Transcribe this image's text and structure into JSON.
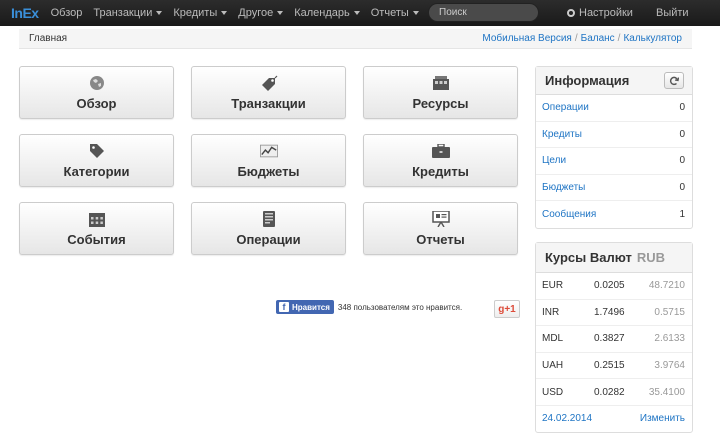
{
  "brand": "InEx",
  "nav": {
    "items": [
      {
        "label": "Обзор",
        "dropdown": false
      },
      {
        "label": "Транзакции",
        "dropdown": true
      },
      {
        "label": "Кредиты",
        "dropdown": true
      },
      {
        "label": "Другое",
        "dropdown": true
      },
      {
        "label": "Календарь",
        "dropdown": true
      },
      {
        "label": "Отчеты",
        "dropdown": true
      }
    ],
    "search_placeholder": "Поиск",
    "settings_label": "Настройки",
    "logout_label": "Выйти"
  },
  "breadcrumb": {
    "current": "Главная",
    "links": [
      "Мобильная Версия",
      "Баланс",
      "Калькулятор"
    ],
    "separator": "/"
  },
  "tiles": [
    {
      "label": "Обзор",
      "icon": "globe-icon"
    },
    {
      "label": "Транзакции",
      "icon": "price-tag-icon"
    },
    {
      "label": "Ресурсы",
      "icon": "building-icon"
    },
    {
      "label": "Категории",
      "icon": "tag-icon"
    },
    {
      "label": "Бюджеты",
      "icon": "chart-icon"
    },
    {
      "label": "Кредиты",
      "icon": "briefcase-icon"
    },
    {
      "label": "События",
      "icon": "calendar-icon"
    },
    {
      "label": "Операции",
      "icon": "receipt-icon"
    },
    {
      "label": "Отчеты",
      "icon": "presentation-icon"
    }
  ],
  "info": {
    "title": "Информация",
    "rows": [
      {
        "label": "Операции",
        "value": "0"
      },
      {
        "label": "Кредиты",
        "value": "0"
      },
      {
        "label": "Цели",
        "value": "0"
      },
      {
        "label": "Бюджеты",
        "value": "0"
      },
      {
        "label": "Сообщения",
        "value": "1"
      }
    ]
  },
  "rates": {
    "title": "Курсы Валют",
    "base": "RUB",
    "rows": [
      {
        "code": "EUR",
        "rate": "0.0205",
        "inverse": "48.7210"
      },
      {
        "code": "INR",
        "rate": "1.7496",
        "inverse": "0.5715"
      },
      {
        "code": "MDL",
        "rate": "0.3827",
        "inverse": "2.6133"
      },
      {
        "code": "UAH",
        "rate": "0.2515",
        "inverse": "3.9764"
      },
      {
        "code": "USD",
        "rate": "0.0282",
        "inverse": "35.4100"
      }
    ],
    "date": "24.02.2014",
    "change_label": "Изменить"
  },
  "social": {
    "fb_label": "Нравится",
    "fb_count_text": "348 пользователям это нравится.",
    "gplus_label": "g+1"
  },
  "colors": {
    "accent": "#1e74c4",
    "navbar": "#1f1f1f",
    "brand": "#3a8fd9",
    "fb": "#4267b2",
    "gplus": "#dd4b39"
  }
}
